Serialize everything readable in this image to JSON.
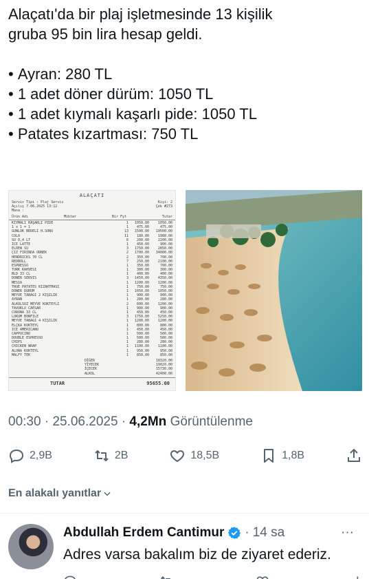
{
  "tweet": {
    "lines": [
      "Alaçatı'da bir plaj işletmesinde 13 kişilik",
      "gruba 95 bin lira hesap geldi."
    ],
    "bullets": [
      "Ayran: 280 TL",
      "1 adet döner dürüm: 1050 TL",
      "1 adet kıymalı kaşarlı pide: 1050 TL",
      "Patates kızartması: 750 TL"
    ],
    "time": "00:30",
    "separator": "·",
    "date": "25.06.2025",
    "views_count": "4,2Mn",
    "views_label": "Görüntülenme"
  },
  "receipt": {
    "header": "ALAÇATI",
    "meta_left": [
      "Servis Tipi : Plaj Servis",
      "Açılış 7.06.2025 13:12",
      "Masa :"
    ],
    "meta_right": [
      "Kişi: 2",
      "Çek #273"
    ],
    "columns": [
      "Ürün Adı",
      "Miktar",
      "Bir Fyt",
      "Tutar"
    ],
    "items": [
      {
        "name": "KIYMALI KAŞARLI PIDE",
        "qty": "1",
        "price": "1050.00",
        "total": "1050.00"
      },
      {
        "name": "1 x 1 = 1",
        "qty": "1",
        "price": "475.00",
        "total": "475.00"
      },
      {
        "name": "GÜNLÜK BEDELİ H.SONU",
        "qty": "13",
        "price": "1500.00",
        "total": "19500.00"
      },
      {
        "name": "COLA",
        "qty": "11",
        "price": "180.00",
        "total": "1980.00"
      },
      {
        "name": "SU 0,4 LT",
        "qty": "6",
        "price": "200.00",
        "total": "2200.00"
      },
      {
        "name": "ICE LATTE",
        "qty": "1",
        "price": "450.00",
        "total": "900.00"
      },
      {
        "name": "ELDEN SU",
        "qty": "3",
        "price": "1750.00",
        "total": "2850.00"
      },
      {
        "name": "ÇİZ FIRINDA ÖRNEK",
        "qty": "2",
        "price": "1700.00",
        "total": "34000.00"
      },
      {
        "name": "HENDRICKS 70 CL",
        "qty": "2",
        "price": "350.00",
        "total": "700.00"
      },
      {
        "name": "REDBULL",
        "qty": "7",
        "price": "250.00",
        "total": "2100.00"
      },
      {
        "name": "ESPRESSO",
        "qty": "1",
        "price": "350.00",
        "total": "700.00"
      },
      {
        "name": "TÜRK KAHVESİ",
        "qty": "1",
        "price": "300.00",
        "total": "300.00"
      },
      {
        "name": "BLD 33 CL",
        "qty": "1",
        "price": "400.00",
        "total": "400.00"
      },
      {
        "name": "DÖNER SERVİS",
        "qty": "3",
        "price": "1450.00",
        "total": "4350.00"
      },
      {
        "name": "MESİA",
        "qty": "1",
        "price": "1200.00",
        "total": "1200.00"
      },
      {
        "name": "TRUE PATATES KIZARTMASI",
        "qty": "1",
        "price": "750.00",
        "total": "750.00"
      },
      {
        "name": "DÖNER DÜRÜM",
        "qty": "1",
        "price": "1050.00",
        "total": "1050.00"
      },
      {
        "name": "MEYVE TABAĞI 2 KİŞİLİK",
        "qty": "1",
        "price": "900.00",
        "total": "900.00"
      },
      {
        "name": "AYRAN",
        "qty": "1",
        "price": "280.00",
        "total": "280.00"
      },
      {
        "name": "ALKOLSÜZ MEYVE KOKTEYLİ",
        "qty": "2",
        "price": "600.00",
        "total": "1200.00"
      },
      {
        "name": "TAVUKLU CAESAR",
        "qty": "1",
        "price": "900.00",
        "total": "900.00"
      },
      {
        "name": "CORONA 33 CL",
        "qty": "1",
        "price": "450.00",
        "total": "450.00"
      },
      {
        "name": "LOKUM BONFİLE",
        "qty": "3",
        "price": "1750.00",
        "total": "5250.00"
      },
      {
        "name": "MEYVE TABAĞI 4 KİŞİLİK",
        "qty": "1",
        "price": "1200.00",
        "total": "1200.00"
      },
      {
        "name": "ELÇKA KOKTEYL",
        "qty": "1",
        "price": "800.00",
        "total": "800.00"
      },
      {
        "name": "ICE AMERICANO",
        "qty": "1",
        "price": "450.00",
        "total": "450.00"
      },
      {
        "name": "CAPPUCINO",
        "qty": "1",
        "price": "500.00",
        "total": "500.00"
      },
      {
        "name": "DOUBLE ESPRESSO",
        "qty": "1",
        "price": "500.00",
        "total": "500.00"
      },
      {
        "name": "CHIPS",
        "qty": "1",
        "price": "280.00",
        "total": "280.00"
      },
      {
        "name": "CHICKEN WRAP",
        "qty": "1",
        "price": "1100.00",
        "total": "1100.00"
      },
      {
        "name": "ALUNA KOKTEYL",
        "qty": "1",
        "price": "950.00",
        "total": "950.00"
      },
      {
        "name": "MALFY TEK",
        "qty": "1",
        "price": "850.00",
        "total": "850.00"
      }
    ],
    "subtotals": [
      {
        "label": "DİĞER",
        "value": "18320.00"
      },
      {
        "label": "YİYECEK",
        "value": "19020.00"
      },
      {
        "label": "İÇECEK",
        "value": "15730.00"
      },
      {
        "label": "ALKOL",
        "value": "42400.00"
      }
    ],
    "total_label": "TUTAR",
    "total_value": "95655.00"
  },
  "actions": {
    "replies": "2,9B",
    "reposts": "2B",
    "likes": "18,5B",
    "bookmarks": "1,8B"
  },
  "replies_section": {
    "label": "En alakalı yanıtlar"
  },
  "reply": {
    "name": "Abdullah Erdem Cantimur",
    "time": "14 sa",
    "text": "Adres varsa bakalım biz de ziyaret ederiz."
  },
  "colors": {
    "text_primary": "#0f1419",
    "text_secondary": "#536471",
    "verified": "#1d9bf0"
  }
}
